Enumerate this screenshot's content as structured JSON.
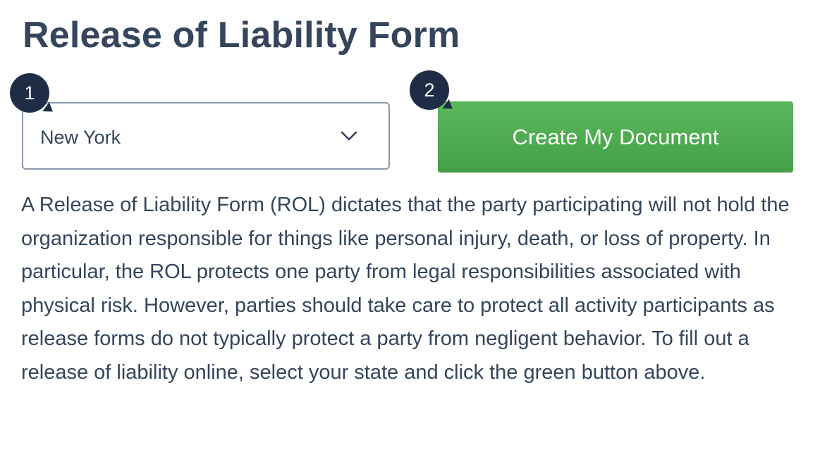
{
  "page": {
    "title": "Release of Liability Form",
    "description": "A Release of Liability Form (ROL) dictates that the party participating will not hold the organization responsible for things like personal injury, death, or loss of property. In particular, the ROL protects one party from legal responsibilities associated with physical risk. However, parties should take care to protect all activity participants as release forms do not typically protect a party from negligent behavior. To fill out a release of liability online, select your state and click the green button above."
  },
  "steps": {
    "step1": "1",
    "step2": "2"
  },
  "state_select": {
    "selected_value": "New York",
    "icon": "chevron-down-icon"
  },
  "actions": {
    "create_label": "Create My Document"
  },
  "colors": {
    "title": "#34455c",
    "badge": "#1e2d45",
    "button_green": "#4caf50",
    "select_border": "#8c99ad"
  }
}
